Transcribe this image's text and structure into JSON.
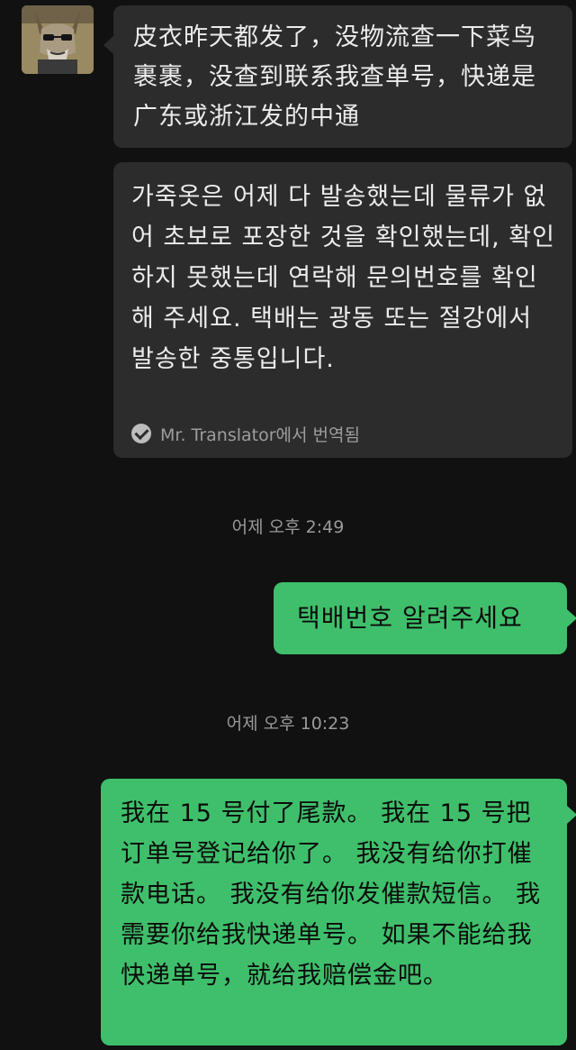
{
  "conversation": {
    "messages": [
      {
        "side": "incoming",
        "text": "皮衣昨天都发了，没物流查一下菜鸟裹裹，没查到联系我查单号，快递是广东或浙江发的中通"
      },
      {
        "side": "incoming",
        "text": "가죽옷은 어제 다 발송했는데 물류가 없어 초보로 포장한 것을 확인했는데, 확인하지 못했는데 연락해 문의번호를 확인해 주세요. 택배는 광동 또는 절강에서 발송한 중통입니다.",
        "translation_note": "Mr. Translator에서 번역됨"
      },
      {
        "side": "outgoing",
        "text": "택배번호 알려주세요"
      },
      {
        "side": "outgoing",
        "text": "我在 15 号付了尾款。 我在 15 号把订单号登记给你了。 我没有给你打催款电话。 我没有给你发催款短信。 我需要你给我快递单号。 如果不能给我快递单号，就给我赔偿金吧。"
      }
    ],
    "timestamps": [
      "어제 오후 2:49",
      "어제 오후 10:23"
    ]
  },
  "colors": {
    "background": "#111111",
    "incoming_bubble": "#2c2c2c",
    "outgoing_bubble": "#3fbf6b"
  },
  "icons": {
    "translator": "check-circle-icon",
    "avatar": "donkey-avatar"
  }
}
